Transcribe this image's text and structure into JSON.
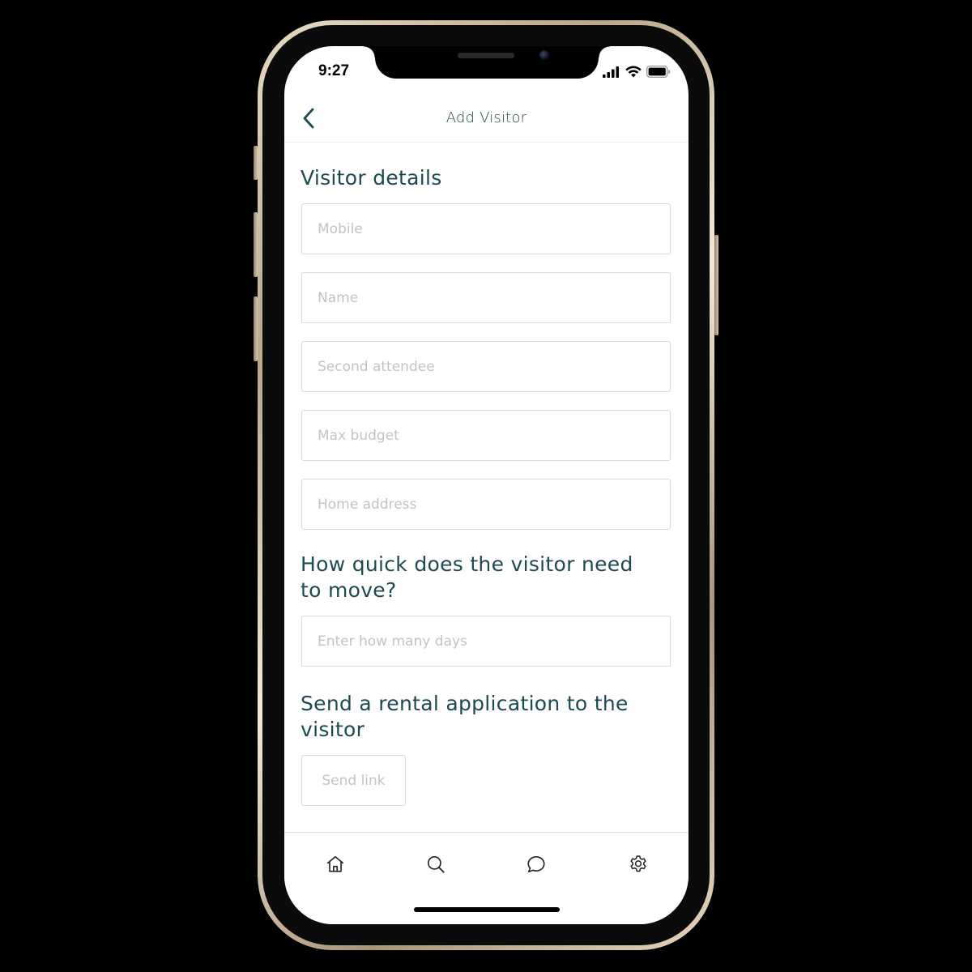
{
  "status_bar": {
    "time": "9:27"
  },
  "header": {
    "title": "Add Visitor",
    "back_icon": "chevron-left-icon"
  },
  "visitor_details": {
    "title": "Visitor details",
    "fields": [
      {
        "placeholder": "Mobile",
        "value": ""
      },
      {
        "placeholder": "Name",
        "value": ""
      },
      {
        "placeholder": "Second attendee",
        "value": ""
      },
      {
        "placeholder": "Max budget",
        "value": ""
      },
      {
        "placeholder": "Home address",
        "value": ""
      }
    ]
  },
  "move_section": {
    "title_line1": "How quick does the visitor need",
    "title_line2": "to move?",
    "days_field": {
      "placeholder": "Enter how many days",
      "value": ""
    }
  },
  "rental_section": {
    "title_line1": "Send a rental application to the",
    "title_line2": "visitor",
    "button_label": "Send link"
  },
  "tabbar": {
    "items": [
      {
        "icon": "home-icon"
      },
      {
        "icon": "search-icon"
      },
      {
        "icon": "chat-bubble-icon"
      },
      {
        "icon": "gear-icon"
      }
    ]
  },
  "colors": {
    "accent": "#1b4a50",
    "placeholder": "#c3c3c3",
    "border": "#d9d9d9",
    "frame": "#d7c7a8"
  }
}
